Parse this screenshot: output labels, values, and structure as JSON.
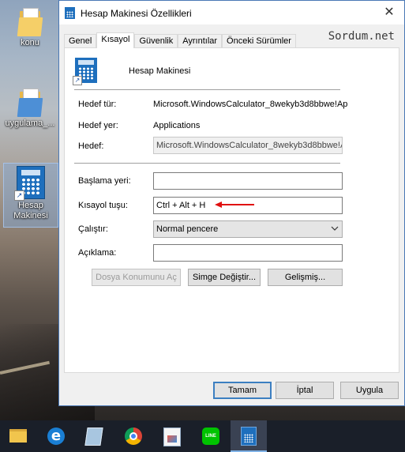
{
  "desktop": {
    "icons": [
      {
        "label": "konu",
        "icon": "folder-icon"
      },
      {
        "label": "uygulama_...",
        "icon": "folder-icon"
      },
      {
        "label": "Hesap Makinesi",
        "icon": "calculator-shortcut-icon"
      }
    ]
  },
  "dialog": {
    "title": "Hesap Makinesi Özellikleri",
    "close_glyph": "✕",
    "watermark": "Sordum.net",
    "tabs": [
      "Genel",
      "Kısayol",
      "Güvenlik",
      "Ayrıntılar",
      "Önceki Sürümler"
    ],
    "active_tab": "Kısayol",
    "app_name": "Hesap Makinesi",
    "target_type_label": "Hedef tür:",
    "target_type_value": "Microsoft.WindowsCalculator_8wekyb3d8bbwe!Ap",
    "target_location_label": "Hedef yer:",
    "target_location_value": "Applications",
    "target_label": "Hedef:",
    "target_value": "Microsoft.WindowsCalculator_8wekyb3d8bbwe!A",
    "start_in_label": "Başlama yeri:",
    "start_in_value": "",
    "shortcut_key_label": "Kısayol tuşu:",
    "shortcut_key_value": "Ctrl + Alt + H",
    "run_label": "Çalıştır:",
    "run_value": "Normal pencere",
    "comment_label": "Açıklama:",
    "comment_value": "",
    "open_location_button": "Dosya Konumunu Aç",
    "change_icon_button": "Simge Değiştir...",
    "advanced_button": "Gelişmiş...",
    "ok_button": "Tamam",
    "cancel_button": "İptal",
    "apply_button": "Uygula"
  },
  "colors": {
    "accent": "#3c7fc1",
    "annotation_arrow": "#e01010"
  },
  "taskbar": {
    "items": [
      "file-explorer-icon",
      "edge-icon",
      "notepad-icon",
      "chrome-icon",
      "paint-icon",
      "line-icon",
      "calculator-icon"
    ],
    "line_text": "LINE",
    "edge_glyph": "e"
  }
}
